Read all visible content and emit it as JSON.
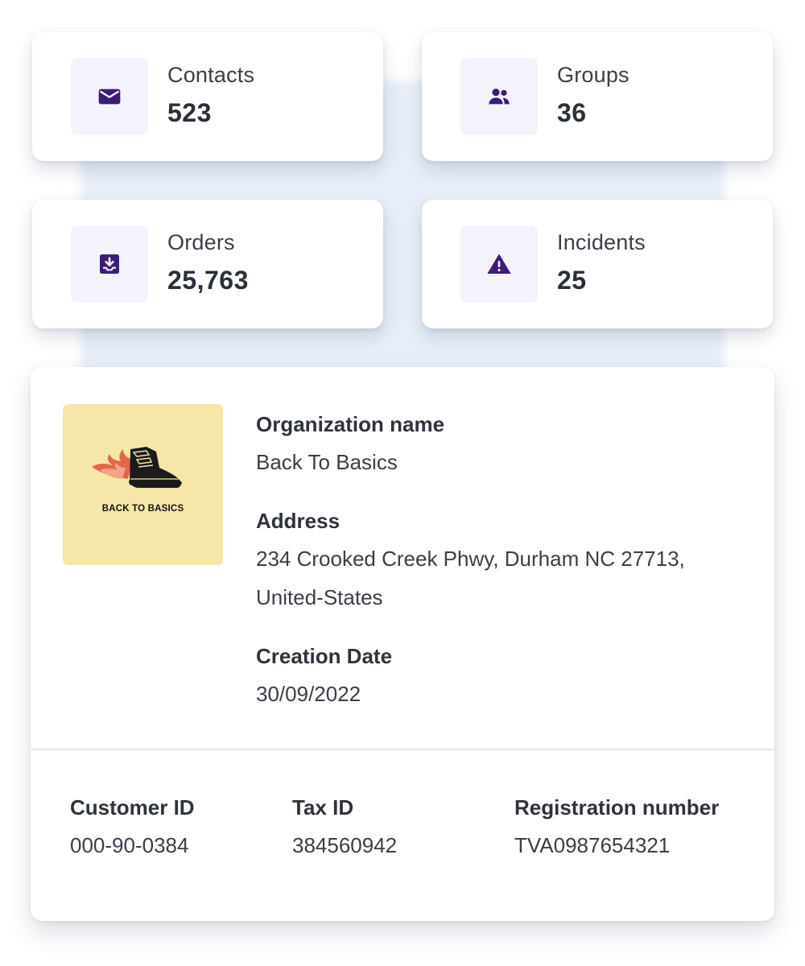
{
  "stats": [
    {
      "label": "Contacts",
      "value": "523",
      "icon": "envelope-icon"
    },
    {
      "label": "Groups",
      "value": "36",
      "icon": "users-icon"
    },
    {
      "label": "Orders",
      "value": "25,763",
      "icon": "inbox-download-icon"
    },
    {
      "label": "Incidents",
      "value": "25",
      "icon": "warning-icon"
    }
  ],
  "colors": {
    "accent": "#3d1b7a",
    "tile_bg": "#f4f3fd",
    "logo_bg": "#f6e7a8"
  },
  "organization": {
    "logo_text": "BACK TO BASICS",
    "name_label": "Organization name",
    "name_value": "Back To Basics",
    "address_label": "Address",
    "address_line1": "234 Crooked Creek Phwy, Durham NC 27713,",
    "address_line2": "United-States",
    "creation_label": "Creation Date",
    "creation_value": "30/09/2022",
    "customer_id_label": "Customer ID",
    "customer_id_value": "000-90-0384",
    "tax_id_label": "Tax ID",
    "tax_id_value": "384560942",
    "registration_label": "Registration number",
    "registration_value": "TVA0987654321"
  }
}
